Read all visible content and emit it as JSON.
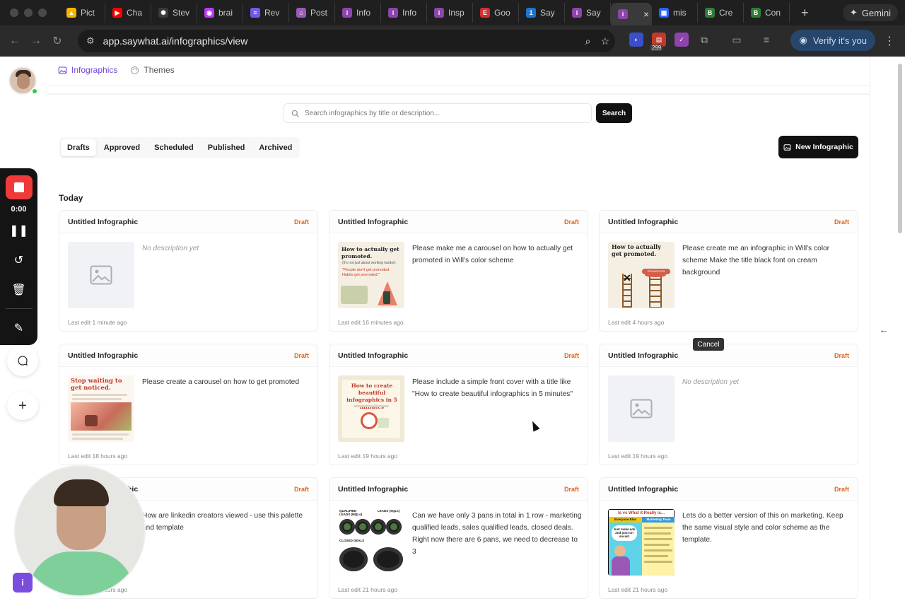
{
  "browser": {
    "tabs": [
      {
        "label": "Pict",
        "color": "#f4b400",
        "glyph": "▲"
      },
      {
        "label": "Cha",
        "color": "#ff0000",
        "glyph": "▶"
      },
      {
        "label": "Stev",
        "color": "#3a3a3a",
        "glyph": "✺"
      },
      {
        "label": "brai",
        "color": "#b83af0",
        "glyph": "◉"
      },
      {
        "label": "Rev",
        "color": "#6c5ce7",
        "glyph": "≡"
      },
      {
        "label": "Post",
        "color": "#9b59b6",
        "glyph": "⌂"
      },
      {
        "label": "Info",
        "color": "#8e44ad",
        "glyph": "i"
      },
      {
        "label": "Info",
        "color": "#8e44ad",
        "glyph": "i"
      },
      {
        "label": "Insp",
        "color": "#8e44ad",
        "glyph": "i"
      },
      {
        "label": "Goo",
        "color": "#d32f2f",
        "glyph": "E"
      },
      {
        "label": "Say",
        "color": "#1976d2",
        "glyph": "1"
      },
      {
        "label": "Say",
        "color": "#8e44ad",
        "glyph": "i"
      },
      {
        "label": "",
        "color": "#8e44ad",
        "glyph": "i",
        "active": true
      },
      {
        "label": "mis",
        "color": "#2962ff",
        "glyph": "▦"
      },
      {
        "label": "Cre",
        "color": "#2e7d32",
        "glyph": "B"
      },
      {
        "label": "Con",
        "color": "#2e7d32",
        "glyph": "B"
      }
    ],
    "gemini_label": "Gemini",
    "url": "app.saywhat.ai/infographics/view",
    "verify_label": "Verify it's you",
    "ext_count": "299"
  },
  "nav": {
    "infographics_label": "Infographics",
    "themes_label": "Themes"
  },
  "search": {
    "placeholder": "Search infographics by title or description...",
    "button_label": "Search"
  },
  "status_tabs": [
    "Drafts",
    "Approved",
    "Scheduled",
    "Published",
    "Archived"
  ],
  "active_status_tab": "Drafts",
  "new_button_label": "New Infographic",
  "section_title": "Today",
  "cards": [
    {
      "title": "Untitled Infographic",
      "status": "Draft",
      "description": "No description yet",
      "empty": true,
      "edited": "Last edit 1 minute ago",
      "thumb": "placeholder"
    },
    {
      "title": "Untitled Infographic",
      "status": "Draft",
      "description": "Please make me a carousel on how to actually get promoted in Will's color scheme",
      "empty": false,
      "edited": "Last edit 16 minutes ago",
      "thumb": "promoted-carousel"
    },
    {
      "title": "Untitled Infographic",
      "status": "Draft",
      "description": "Please create me an infographic in Will's color scheme Make the title black font on cream background",
      "empty": false,
      "edited": "Last edit 4 hours ago",
      "thumb": "ladders"
    },
    {
      "title": "Untitled Infographic",
      "status": "Draft",
      "description": "Please create a carousel on how to get promoted",
      "empty": false,
      "edited": "Last edit 18 hours ago",
      "thumb": "stop-waiting"
    },
    {
      "title": "Untitled Infographic",
      "status": "Draft",
      "description": "Please include a simple front cover with a title like \"How to create beautiful infographics in 5 minutes\"",
      "empty": false,
      "edited": "Last edit 19 hours ago",
      "thumb": "beautiful-infographics"
    },
    {
      "title": "Untitled Infographic",
      "status": "Draft",
      "description": "No description yet",
      "empty": true,
      "edited": "Last edit 19 hours ago",
      "thumb": "placeholder"
    },
    {
      "title": "Untitled Infographic",
      "status": "Draft",
      "description": "How are linkedin creators viewed - use this palette and template",
      "empty": false,
      "edited": "Last edit 21 hours ago",
      "thumb": "hidden"
    },
    {
      "title": "Untitled Infographic",
      "status": "Draft",
      "description": "Can we have only 3 pans in total in 1 row - marketing qualified leads, sales qualified leads, closed deals. Right now there are 6 pans, we need to decrease to 3",
      "empty": false,
      "edited": "Last edit 21 hours ago",
      "thumb": "pans"
    },
    {
      "title": "Untitled Infographic",
      "status": "Draft",
      "description": "Lets do a better version of this on marketing. Keep the same visual style and color scheme as the template.",
      "empty": false,
      "edited": "Last edit 21 hours ago",
      "thumb": "comic"
    }
  ],
  "thumbs": {
    "promoted_title": "How to actually get promoted.",
    "promoted_sub": "(It's not just about working harder).",
    "promoted_quote": "\"People don't get promoted. Habits get promoted.\"",
    "ladders_title": "How to actually get promoted.",
    "ladders_label": "PROMOTION",
    "stop_title": "Stop waiting to get noticed.",
    "beautiful_title": "How to create beautiful infographics in 5 minutes",
    "pans_qualified": "QUALIFIED LEADS (MQLs)",
    "pans_sales": "LEADS (SQLs)",
    "pans_closed": "CLOSED DEALS",
    "comic_title": "Is vs What it Really is...",
    "comic_left": "Everyone Else",
    "comic_right": "Marketing Team",
    "comic_bubble": "Just make ads and post on social!"
  },
  "recorder": {
    "time": "0:00"
  },
  "tooltip": "Cancel",
  "colors": {
    "accent": "#6b43d6",
    "draft": "#e0661b",
    "record": "#ef3a3a"
  }
}
